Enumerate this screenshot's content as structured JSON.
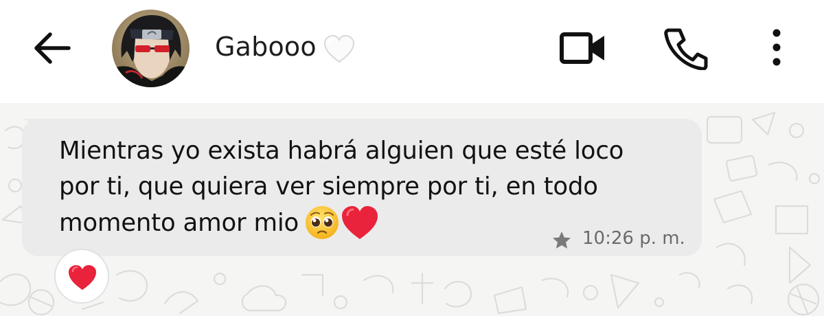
{
  "header": {
    "contact_name": "Gabooo",
    "name_emoji": "white-heart-emoji",
    "icons": [
      "back-arrow-icon",
      "contact-avatar",
      "video-call-icon",
      "phone-call-icon",
      "more-vertical-icon"
    ]
  },
  "message": {
    "text": "Mientras yo exista habrá alguien que esté loco por ti, que quiera ver siempre por ti, en todo momento amor mio",
    "emojis": [
      "pleading-face-emoji",
      "red-heart-emoji"
    ],
    "timestamp": "10:26 p. m.",
    "starred": true,
    "reaction": "red-heart-emoji"
  },
  "colors": {
    "header_bg": "#ffffff",
    "chat_bg": "#f5f5f4",
    "bubble_bg": "#ebebeb",
    "text": "#121212",
    "meta_text": "#6a6a6a",
    "heart_red": "#e8233b"
  }
}
